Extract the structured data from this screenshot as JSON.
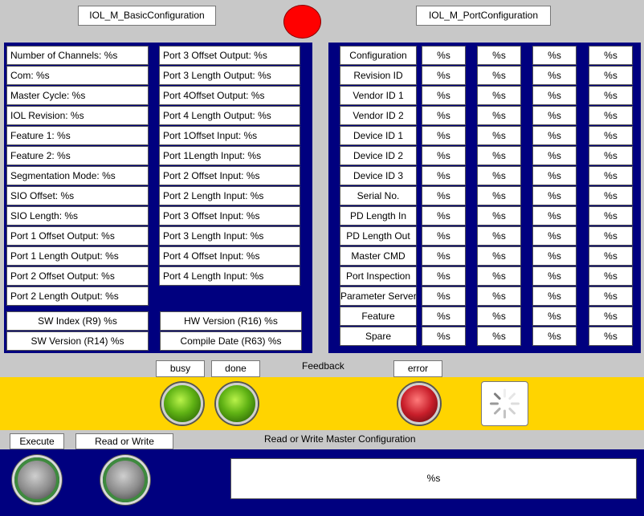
{
  "header": {
    "basic_tab": "IOL_M_BasicConfiguration",
    "port_tab": "IOL_M_PortConfiguration",
    "status_color": "#ff0000"
  },
  "basic": {
    "col1": [
      "Number of Channels:  %s",
      "Com:  %s",
      "Master Cycle:  %s",
      "IOL Revision:  %s",
      "Feature 1:  %s",
      "Feature 2:  %s",
      "Segmentation Mode:  %s",
      "SIO Offset:  %s",
      "SIO Length: %s",
      "Port 1 Offset Output: %s",
      "Port 1 Length Output:  %s",
      "Port 2 Offset Output:  %s",
      "Port 2 Length Output:  %s"
    ],
    "col2": [
      "Port 3 Offset Output:  %s",
      "Port 3 Length Output:  %s",
      "Port 4Offset Output:  %s",
      "Port 4 Length Output:  %s",
      "Port 1Offset Input:  %s",
      "Port 1Length Input:  %s",
      "Port 2 Offset Input:  %s",
      "Port 2 Length Input:  %s",
      "Port 3 Offset Input:  %s",
      "Port 3 Length Input:  %s",
      "Port 4 Offset Input:  %s",
      "Port 4 Length Input:  %s"
    ],
    "sw_index": "SW Index (R9)  %s",
    "sw_version": "SW Version (R14)  %s",
    "hw_version": "HW Version (R16)  %s",
    "compile_date": "Compile Date (R63)  %s"
  },
  "port": {
    "labels": [
      "Configuration",
      "Revision ID",
      "Vendor ID 1",
      "Vendor ID 2",
      "Device ID 1",
      "Device ID 2",
      "Device ID 3",
      "Serial No.",
      "PD Length In",
      "PD Length Out",
      "Master CMD",
      "Port Inspection",
      "Parameter Server",
      "Feature",
      "Spare"
    ],
    "value": "%s"
  },
  "feedback": {
    "title": "Feedback",
    "busy": "busy",
    "done": "done",
    "error": "error",
    "yellow": "#ffd400"
  },
  "bottom": {
    "execute": "Execute",
    "read_or_write": "Read or Write",
    "title": "Read or Write Master Configuration",
    "output": "%s"
  }
}
